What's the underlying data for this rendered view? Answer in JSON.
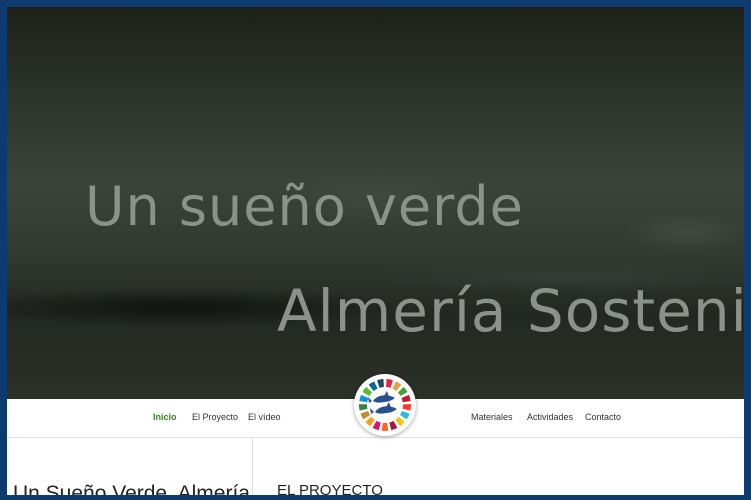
{
  "hero": {
    "line1": "Un sueño verde",
    "line2": "Almería Sostenible"
  },
  "nav": {
    "left": [
      {
        "label": "Inicio",
        "active": true
      },
      {
        "label": "El Proyecto",
        "active": false
      },
      {
        "label": "El vídeo",
        "active": false
      }
    ],
    "right": [
      {
        "label": "Materiales",
        "active": false
      },
      {
        "label": "Actividades",
        "active": false
      },
      {
        "label": "Contacto",
        "active": false
      }
    ]
  },
  "logo": {
    "icon": "sdg-wheel-dolphins-icon",
    "wheel_colors": [
      "#e5243b",
      "#dda63a",
      "#4c9f38",
      "#c5192d",
      "#ff3a21",
      "#26bde2",
      "#fcc30b",
      "#a21942",
      "#fd6925",
      "#dd1367",
      "#fd9d24",
      "#bf8b2e",
      "#3f7e44",
      "#0a97d9",
      "#56c02b",
      "#00689d",
      "#19486a"
    ],
    "dolphin_color": "#2a4f8f"
  },
  "content": {
    "site_title": "Un Sueño Verde, Almería",
    "section_title": "EL PROYECTO"
  },
  "colors": {
    "frame": "#0d3b6e",
    "nav_active": "#3f7d2c"
  }
}
